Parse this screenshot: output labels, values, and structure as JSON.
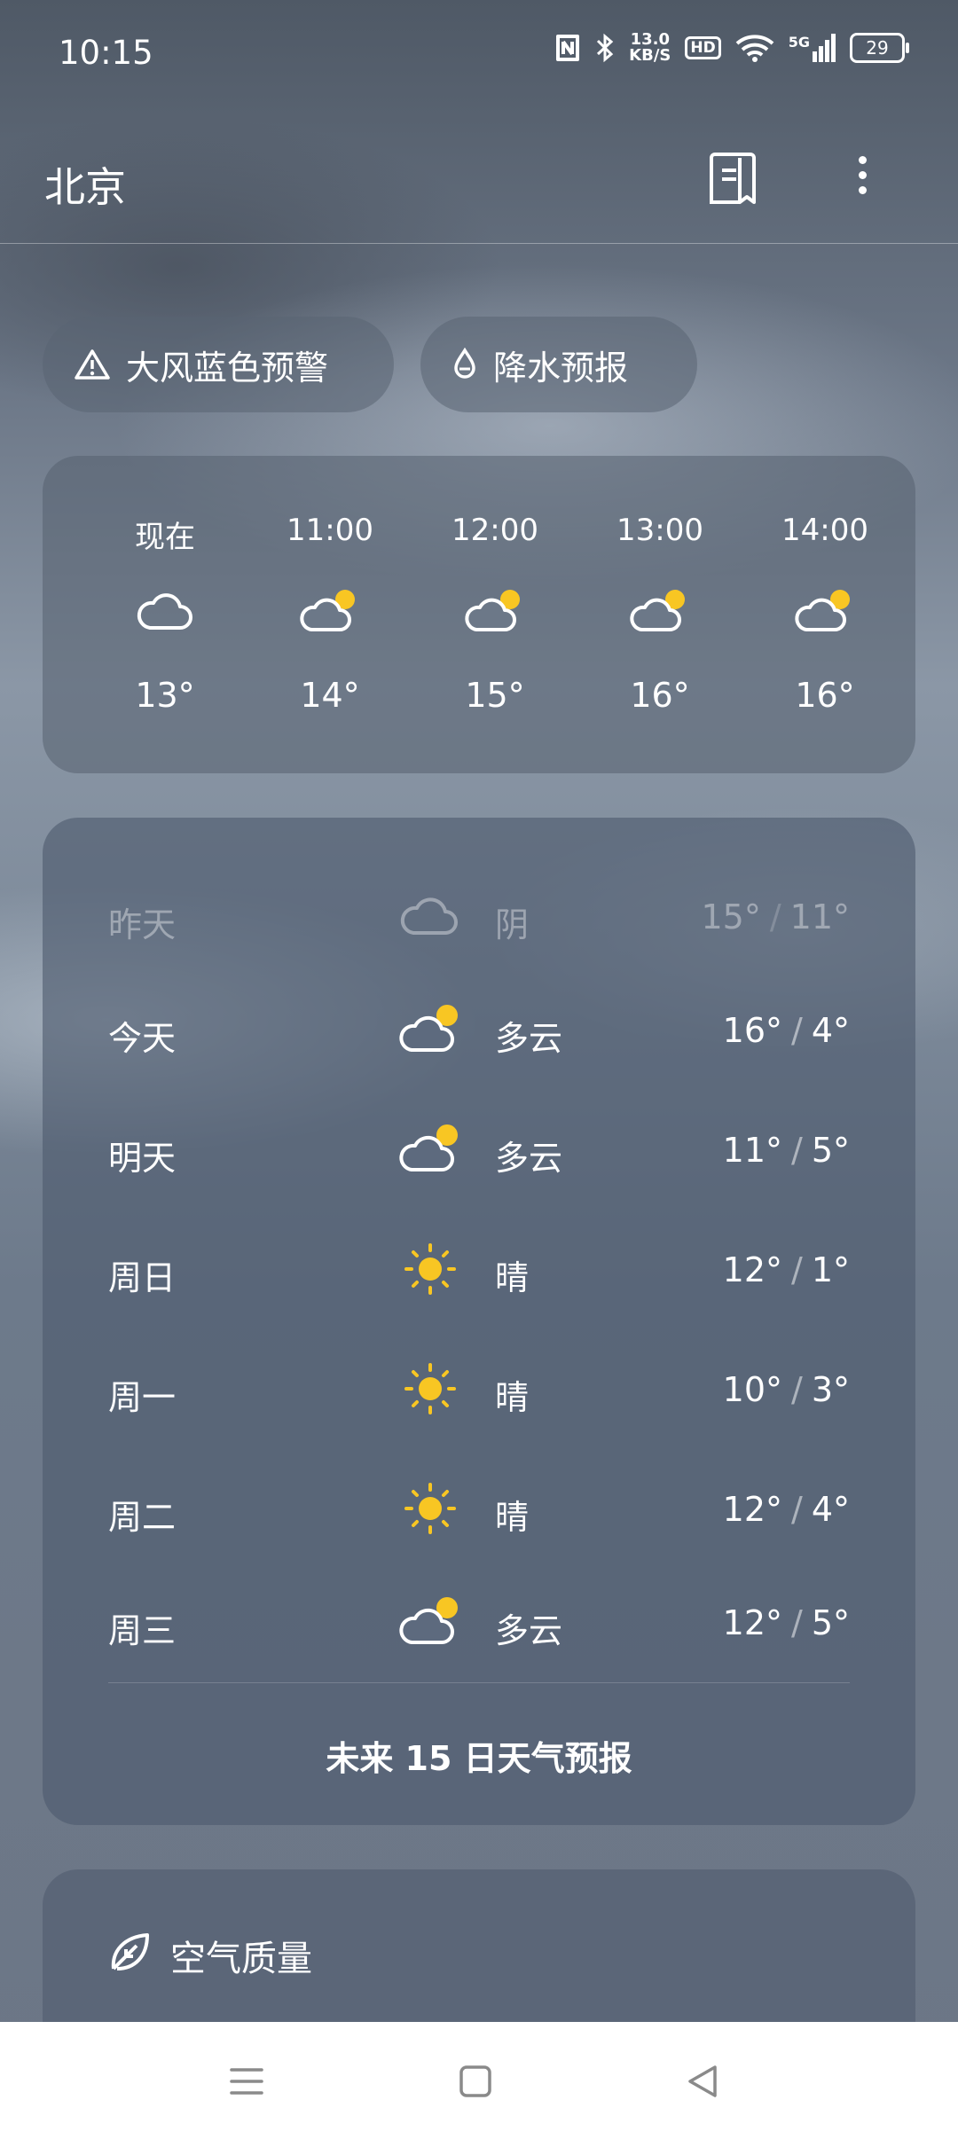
{
  "status_bar": {
    "time": "10:15",
    "net_speed_value": "13.0",
    "net_speed_unit": "KB/S",
    "hd": "HD",
    "network": "5G",
    "battery": "29"
  },
  "header": {
    "city": "北京"
  },
  "chips": {
    "warning": "大风蓝色预警",
    "rain": "降水预报"
  },
  "hourly": [
    {
      "time": "现在",
      "icon": "cloud-icon",
      "temp": "13°"
    },
    {
      "time": "11:00",
      "icon": "partly-cloudy-icon",
      "temp": "14°"
    },
    {
      "time": "12:00",
      "icon": "partly-cloudy-icon",
      "temp": "15°"
    },
    {
      "time": "13:00",
      "icon": "partly-cloudy-icon",
      "temp": "16°"
    },
    {
      "time": "14:00",
      "icon": "partly-cloudy-icon",
      "temp": "16°"
    }
  ],
  "daily": [
    {
      "day": "昨天",
      "icon": "cloud-icon",
      "condition": "阴",
      "high": "15°",
      "low": "11°"
    },
    {
      "day": "今天",
      "icon": "partly-cloudy-icon",
      "condition": "多云",
      "high": "16°",
      "low": "4°"
    },
    {
      "day": "明天",
      "icon": "partly-cloudy-icon",
      "condition": "多云",
      "high": "11°",
      "low": "5°"
    },
    {
      "day": "周日",
      "icon": "sun-icon",
      "condition": "晴",
      "high": "12°",
      "low": "1°"
    },
    {
      "day": "周一",
      "icon": "sun-icon",
      "condition": "晴",
      "high": "10°",
      "low": "3°"
    },
    {
      "day": "周二",
      "icon": "sun-icon",
      "condition": "晴",
      "high": "12°",
      "low": "4°"
    },
    {
      "day": "周三",
      "icon": "partly-cloudy-icon",
      "condition": "多云",
      "high": "12°",
      "low": "5°"
    }
  ],
  "daily_separator": "/",
  "forecast_link": "未来 15 日天气预报",
  "air": {
    "label": "空气质量"
  },
  "colors": {
    "sun": "#F8C623",
    "text": "#FFFFFF",
    "nav_bg": "#FFFFFF",
    "nav_icon": "#8A8A8A"
  }
}
